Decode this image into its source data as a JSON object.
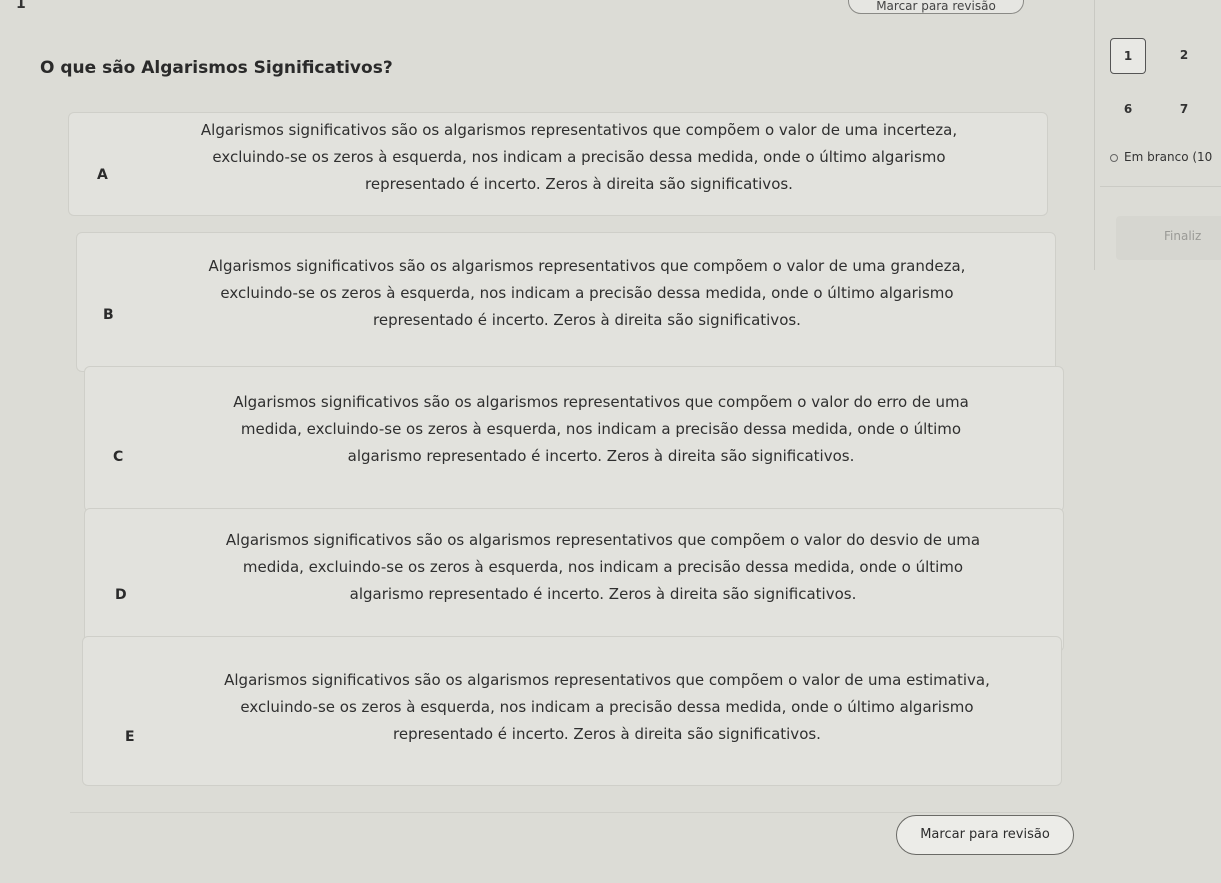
{
  "header": {
    "question_number": "1",
    "top_mark_label": "Marcar para revisão"
  },
  "question": {
    "title": "O que são Algarismos Significativos?"
  },
  "options": [
    {
      "letter": "A",
      "lines": [
        "Algarismos significativos são os algarismos representativos que compõem o valor de uma incerteza,",
        "excluindo-se os zeros à esquerda, nos indicam a precisão dessa medida, onde o último algarismo",
        "representado é incerto. Zeros à direita são significativos."
      ]
    },
    {
      "letter": "B",
      "lines": [
        "Algarismos significativos são os algarismos representativos que compõem o valor de uma grandeza,",
        "excluindo-se os zeros à esquerda, nos indicam a precisão dessa medida, onde o último algarismo",
        "representado é incerto. Zeros à direita são significativos."
      ]
    },
    {
      "letter": "C",
      "lines": [
        "Algarismos significativos são os algarismos representativos que compõem o valor do erro de uma",
        "medida, excluindo-se os zeros à esquerda, nos indicam a precisão dessa medida, onde o último",
        "algarismo representado é incerto. Zeros à direita são significativos."
      ]
    },
    {
      "letter": "D",
      "lines": [
        "Algarismos significativos são os algarismos representativos que compõem o valor do desvio de uma",
        "medida, excluindo-se os zeros à esquerda, nos indicam a precisão dessa medida, onde o último",
        "algarismo representado é incerto. Zeros à direita são significativos."
      ]
    },
    {
      "letter": "E",
      "lines": [
        "Algarismos significativos são os algarismos representativos que compõem o valor de uma estimativa,",
        "excluindo-se os zeros à esquerda, nos indicam a precisão dessa medida, onde o último algarismo",
        "representado é incerto. Zeros à direita são significativos."
      ]
    }
  ],
  "side_panel": {
    "nav": [
      "1",
      "2",
      "6",
      "7"
    ],
    "legend_label": "Em branco (10",
    "finalize_label": "Finaliz"
  },
  "footer": {
    "mark_review_label": "Marcar para revisão"
  }
}
